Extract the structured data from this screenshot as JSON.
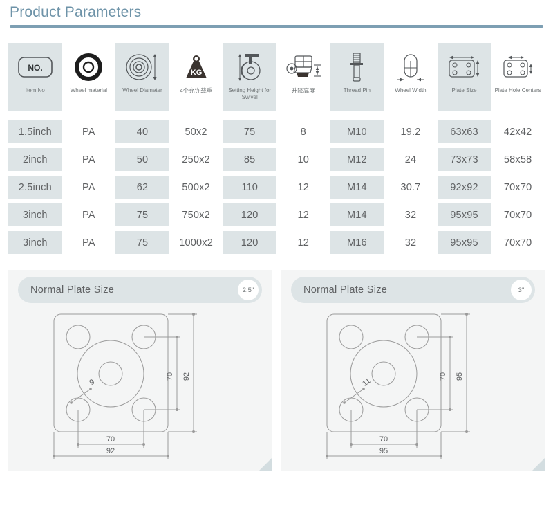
{
  "page_title": "Product Parameters",
  "columns": [
    {
      "icon": "no-badge-icon",
      "label": "Item No",
      "shade": "gray"
    },
    {
      "icon": "wheel-material-icon",
      "label": "Wheel material",
      "shade": "white"
    },
    {
      "icon": "wheel-diameter-icon",
      "label": "Wheel Diameter",
      "shade": "gray"
    },
    {
      "icon": "load-capacity-kg-icon",
      "label": "4个允许载重",
      "shade": "white"
    },
    {
      "icon": "setting-height-icon",
      "label": "Setting Height for Swivel",
      "shade": "gray"
    },
    {
      "icon": "lift-height-icon",
      "label": "升降高度",
      "shade": "white"
    },
    {
      "icon": "thread-pin-icon",
      "label": "Thread Pin",
      "shade": "gray"
    },
    {
      "icon": "wheel-width-icon",
      "label": "Wheel Width",
      "shade": "white"
    },
    {
      "icon": "plate-size-icon",
      "label": "Plate Size",
      "shade": "gray"
    },
    {
      "icon": "plate-hole-centers-icon",
      "label": "Plate Hole Centers",
      "shade": "white"
    }
  ],
  "rows": [
    [
      "1.5inch",
      "PA",
      "40",
      "50x2",
      "75",
      "8",
      "M10",
      "19.2",
      "63x63",
      "42x42"
    ],
    [
      "2inch",
      "PA",
      "50",
      "250x2",
      "85",
      "10",
      "M12",
      "24",
      "73x73",
      "58x58"
    ],
    [
      "2.5inch",
      "PA",
      "62",
      "500x2",
      "110",
      "12",
      "M14",
      "30.7",
      "92x92",
      "70x70"
    ],
    [
      "3inch",
      "PA",
      "75",
      "750x2",
      "120",
      "12",
      "M14",
      "32",
      "95x95",
      "70x70"
    ],
    [
      "3inch",
      "PA",
      "75",
      "1000x2",
      "120",
      "12",
      "M16",
      "32",
      "95x95",
      "70x70"
    ]
  ],
  "panels": [
    {
      "title": "Normal Plate Size",
      "badge": "2.5\"",
      "dims": {
        "width_overall": "92",
        "height_overall": "92",
        "hole_centers_x": "70",
        "hole_centers_y": "70",
        "hole_diameter": "9"
      }
    },
    {
      "title": "Normal Plate Size",
      "badge": "3\"",
      "dims": {
        "width_overall": "95",
        "height_overall": "95",
        "hole_centers_x": "70",
        "hole_centers_y": "70",
        "hole_diameter": "11"
      }
    }
  ],
  "colors": {
    "title": "#6e93a8",
    "rule": "#7d9fb3",
    "cell_gray": "#dde4e6",
    "cell_white": "#ffffff",
    "panel_bg": "#f4f5f5",
    "text": "#5f6163"
  }
}
